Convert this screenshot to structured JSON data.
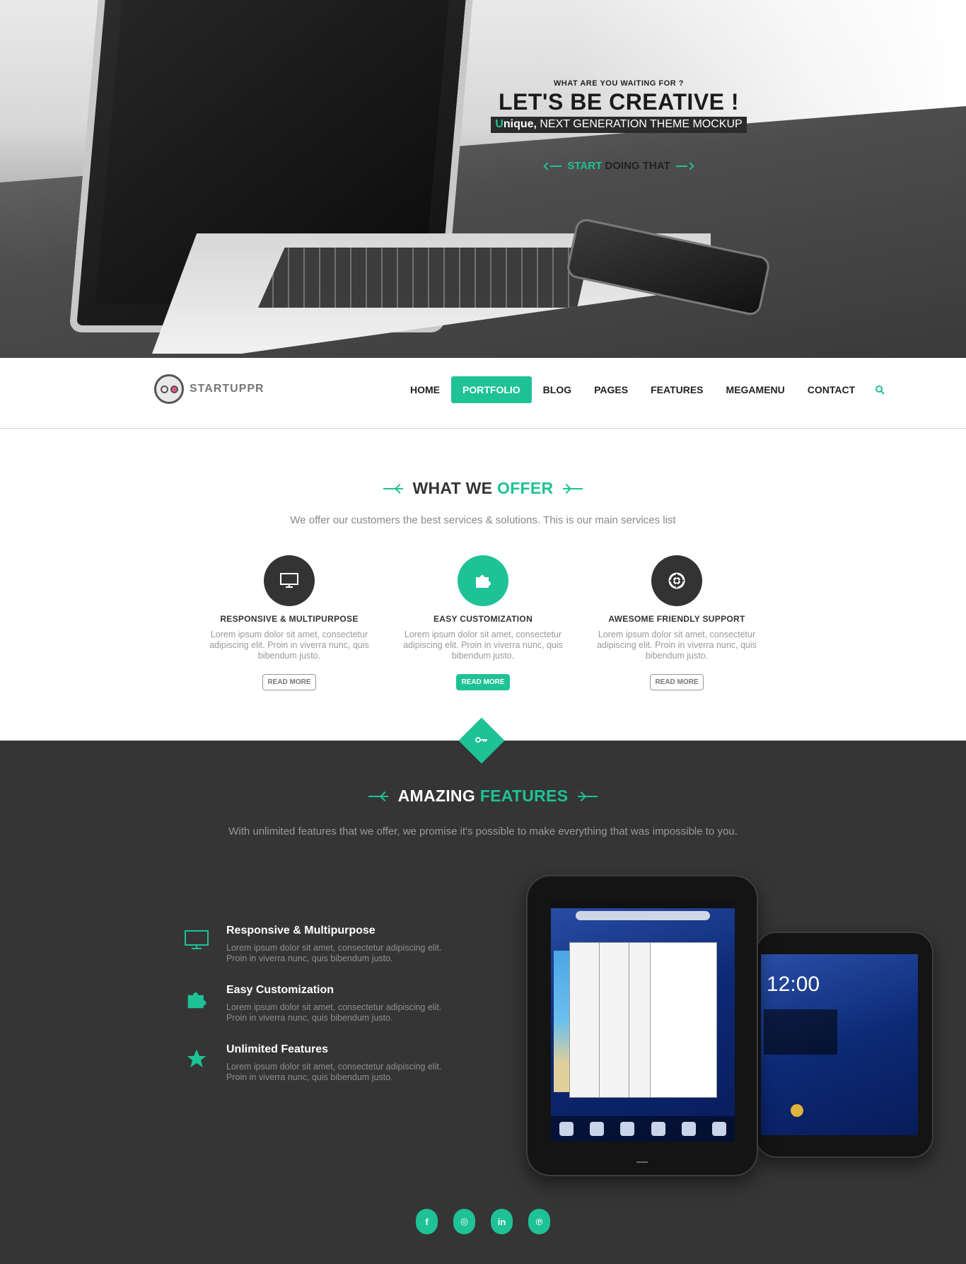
{
  "hero": {
    "eyebrow": "WHAT ARE YOU WAITING FOR ?",
    "title": "LET'S BE CREATIVE !",
    "sub_first_letter": "U",
    "sub_strong_rest": "nique,",
    "sub_rest": " NEXT GENERATION THEME MOCKUP",
    "cta_accent": "START",
    "cta_rest": " DOING THAT"
  },
  "brand": {
    "name": "STARTUPPR"
  },
  "nav": {
    "items": [
      "HOME",
      "PORTFOLIO",
      "BLOG",
      "PAGES",
      "FEATURES",
      "MEGAMENU",
      "CONTACT"
    ],
    "active_index": 1
  },
  "offer": {
    "title_plain": "WHAT WE ",
    "title_accent": "OFFER",
    "subtitle": "We offer our customers the best services & solutions. This is our main services list",
    "services": [
      {
        "icon": "monitor-icon",
        "title": "RESPONSIVE & MULTIPURPOSE",
        "text": "Lorem ipsum dolor sit amet, consectetur adipiscing elit. Proin in viverra nunc, quis bibendum justo.",
        "button": "READ MORE",
        "highlighted": false
      },
      {
        "icon": "puzzle-icon",
        "title": "EASY CUSTOMIZATION",
        "text": "Lorem ipsum dolor sit amet, consectetur adipiscing elit. Proin in viverra nunc, quis bibendum justo.",
        "button": "READ MORE",
        "highlighted": true
      },
      {
        "icon": "lifebuoy-icon",
        "title": "AWESOME FRIENDLY SUPPORT",
        "text": "Lorem ipsum dolor sit amet, consectetur adipiscing elit. Proin in viverra nunc, quis bibendum justo.",
        "button": "READ MORE",
        "highlighted": false
      }
    ]
  },
  "features": {
    "divider_icon": "key-icon",
    "title_plain": "AMAZING ",
    "title_accent": "FEATURES",
    "subtitle": "With unlimited features that we offer, we promise it's possible to make everything that was impossible to you.",
    "items": [
      {
        "icon": "monitor-icon",
        "title": "Responsive & Multipurpose",
        "text": "Lorem ipsum dolor sit amet, consectetur adipiscing elit. Proin in viverra nunc, quis bibendum justo."
      },
      {
        "icon": "puzzle-icon",
        "title": "Easy Customization",
        "text": "Lorem ipsum dolor sit amet, consectetur adipiscing elit. Proin in viverra nunc, quis bibendum justo."
      },
      {
        "icon": "star-icon",
        "title": "Unlimited Features",
        "text": "Lorem ipsum dolor sit amet, consectetur adipiscing elit. Proin in viverra nunc, quis bibendum justo."
      }
    ],
    "tablet_clock": "12:00"
  },
  "socials": [
    {
      "icon": "facebook-icon",
      "glyph": "f"
    },
    {
      "icon": "instagram-icon",
      "glyph": "◎"
    },
    {
      "icon": "linkedin-icon",
      "glyph": "in"
    },
    {
      "icon": "pinterest-icon",
      "glyph": "℗"
    }
  ],
  "colors": {
    "accent": "#1ec296",
    "dark": "#353535"
  }
}
